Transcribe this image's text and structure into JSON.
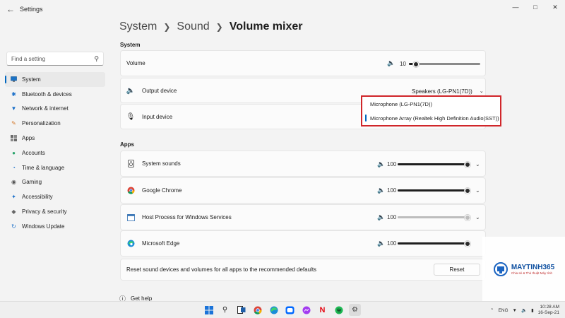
{
  "window": {
    "title": "Settings"
  },
  "sidebar": {
    "search_placeholder": "Find a setting",
    "items": [
      {
        "label": "System",
        "icon": "system-icon",
        "active": true
      },
      {
        "label": "Bluetooth & devices",
        "icon": "bluetooth-icon"
      },
      {
        "label": "Network & internet",
        "icon": "network-icon"
      },
      {
        "label": "Personalization",
        "icon": "brush-icon"
      },
      {
        "label": "Apps",
        "icon": "apps-icon"
      },
      {
        "label": "Accounts",
        "icon": "person-icon"
      },
      {
        "label": "Time & language",
        "icon": "globe-clock-icon"
      },
      {
        "label": "Gaming",
        "icon": "gamepad-icon"
      },
      {
        "label": "Accessibility",
        "icon": "accessibility-icon"
      },
      {
        "label": "Privacy & security",
        "icon": "shield-icon"
      },
      {
        "label": "Windows Update",
        "icon": "update-icon"
      }
    ]
  },
  "breadcrumb": {
    "part1": "System",
    "part2": "Sound",
    "current": "Volume mixer"
  },
  "system_section": {
    "heading": "System",
    "volume_label": "Volume",
    "volume_value": "10",
    "volume_level": 0.1,
    "output_label": "Output device",
    "output_value": "Speakers (LG-PN1(7D))",
    "input_label": "Input device"
  },
  "input_popup": {
    "options": [
      {
        "label": "Microphone (LG-PN1(7D))",
        "selected": false
      },
      {
        "label": "Microphone Array (Realtek High Definition Audio(SST))",
        "selected": true
      }
    ]
  },
  "apps_section": {
    "heading": "Apps",
    "apps": [
      {
        "name": "System sounds",
        "volume": "100",
        "level": 1.0,
        "icon": "system-sounds-icon"
      },
      {
        "name": "Google Chrome",
        "volume": "100",
        "level": 1.0,
        "icon": "chrome-icon"
      },
      {
        "name": "Host Process for Windows Services",
        "volume": "100",
        "level": 1.0,
        "icon": "host-process-icon"
      },
      {
        "name": "Microsoft Edge",
        "volume": "100",
        "level": 1.0,
        "icon": "edge-icon"
      }
    ],
    "reset_text": "Reset sound devices and volumes for all apps to the recommended defaults",
    "reset_button": "Reset"
  },
  "get_help": "Get help",
  "taskbar": {
    "language": "ENG",
    "time": "10:28 AM",
    "date": "16-Sep-21"
  },
  "watermark": {
    "brand": "MAYTINH365",
    "tagline": "Chia sẻ & Thủ thuật Máy tính"
  },
  "colors": {
    "accent": "#0067c0",
    "highlight_border": "#d0262a",
    "background": "#f3f3f3"
  }
}
